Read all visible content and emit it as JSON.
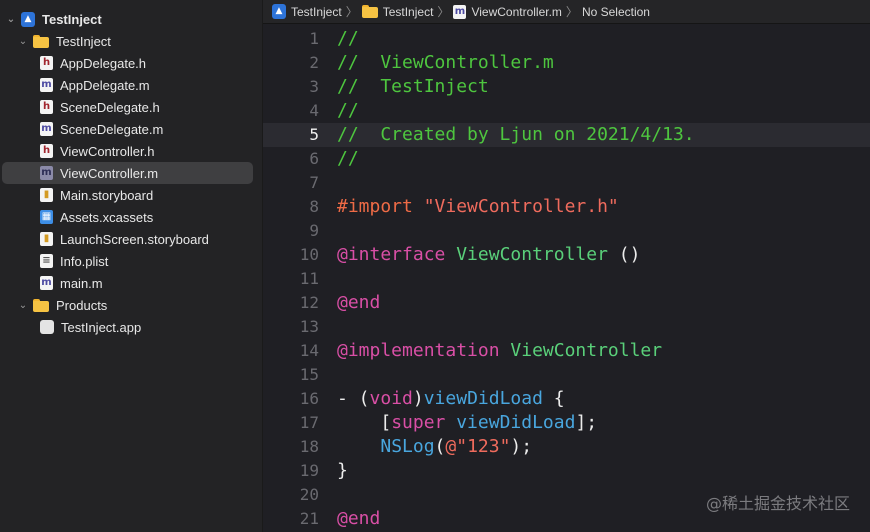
{
  "navigator": {
    "items": [
      {
        "label": "TestInject",
        "icon": "xcode-project-icon",
        "chevron": "⌄",
        "depth": 0,
        "bold": true
      },
      {
        "label": "TestInject",
        "icon": "folder-icon",
        "chevron": "⌄",
        "depth": 1
      },
      {
        "label": "AppDelegate.h",
        "icon": "header-file-icon",
        "badge": "h",
        "depth": 2
      },
      {
        "label": "AppDelegate.m",
        "icon": "objc-file-icon",
        "badge": "m",
        "depth": 2
      },
      {
        "label": "SceneDelegate.h",
        "icon": "header-file-icon",
        "badge": "h",
        "depth": 2
      },
      {
        "label": "SceneDelegate.m",
        "icon": "objc-file-icon",
        "badge": "m",
        "depth": 2
      },
      {
        "label": "ViewController.h",
        "icon": "header-file-icon",
        "badge": "h",
        "depth": 2
      },
      {
        "label": "ViewController.m",
        "icon": "objc-file-icon",
        "badge": "m",
        "depth": 2,
        "selected": true
      },
      {
        "label": "Main.storyboard",
        "icon": "storyboard-file-icon",
        "depth": 2
      },
      {
        "label": "Assets.xcassets",
        "icon": "asset-catalog-icon",
        "depth": 2
      },
      {
        "label": "LaunchScreen.storyboard",
        "icon": "storyboard-file-icon",
        "depth": 2
      },
      {
        "label": "Info.plist",
        "icon": "plist-file-icon",
        "depth": 2
      },
      {
        "label": "main.m",
        "icon": "objc-file-icon",
        "badge": "m",
        "depth": 2
      },
      {
        "label": "Products",
        "icon": "folder-icon",
        "chevron": "⌄",
        "depth": 1
      },
      {
        "label": "TestInject.app",
        "icon": "app-product-icon",
        "depth": 2
      }
    ]
  },
  "breadcrumb": {
    "items": [
      {
        "label": "TestInject",
        "icon": "xcode-project-icon"
      },
      {
        "label": "TestInject",
        "icon": "folder-icon"
      },
      {
        "label": "ViewController.m",
        "icon": "objc-file-icon"
      },
      {
        "label": "No Selection"
      }
    ],
    "separator": "〉"
  },
  "editor": {
    "current_line": 5,
    "lines": [
      {
        "n": "1",
        "tokens": [
          [
            "c-comment",
            "//"
          ]
        ]
      },
      {
        "n": "2",
        "tokens": [
          [
            "c-comment",
            "//  ViewController.m"
          ]
        ]
      },
      {
        "n": "3",
        "tokens": [
          [
            "c-comment",
            "//  TestInject"
          ]
        ]
      },
      {
        "n": "4",
        "tokens": [
          [
            "c-comment",
            "//"
          ]
        ]
      },
      {
        "n": "5",
        "tokens": [
          [
            "c-comment",
            "//  Created by Ljun on 2021/4/13."
          ]
        ]
      },
      {
        "n": "6",
        "tokens": [
          [
            "c-comment",
            "//"
          ]
        ]
      },
      {
        "n": "7",
        "tokens": []
      },
      {
        "n": "8",
        "tokens": [
          [
            "c-pre",
            "#import "
          ],
          [
            "c-str",
            "\"ViewController.h\""
          ]
        ]
      },
      {
        "n": "9",
        "tokens": []
      },
      {
        "n": "10",
        "tokens": [
          [
            "c-kw",
            "@interface "
          ],
          [
            "c-cls",
            "ViewController"
          ],
          [
            "c-plain",
            " ()"
          ]
        ]
      },
      {
        "n": "11",
        "tokens": []
      },
      {
        "n": "12",
        "tokens": [
          [
            "c-kw",
            "@end"
          ]
        ]
      },
      {
        "n": "13",
        "tokens": []
      },
      {
        "n": "14",
        "tokens": [
          [
            "c-kw",
            "@implementation "
          ],
          [
            "c-cls",
            "ViewController"
          ]
        ]
      },
      {
        "n": "15",
        "tokens": []
      },
      {
        "n": "16",
        "tokens": [
          [
            "c-plain",
            "- ("
          ],
          [
            "c-kw",
            "void"
          ],
          [
            "c-plain",
            ")"
          ],
          [
            "c-fn",
            "viewDidLoad"
          ],
          [
            "c-plain",
            " {"
          ]
        ]
      },
      {
        "n": "17",
        "tokens": [
          [
            "c-plain",
            "    ["
          ],
          [
            "c-kw",
            "super"
          ],
          [
            "c-plain",
            " "
          ],
          [
            "c-fn",
            "viewDidLoad"
          ],
          [
            "c-plain",
            "];"
          ]
        ]
      },
      {
        "n": "18",
        "tokens": [
          [
            "c-plain",
            "    "
          ],
          [
            "c-fn",
            "NSLog"
          ],
          [
            "c-plain",
            "("
          ],
          [
            "c-str",
            "@\"123\""
          ],
          [
            "c-plain",
            ");"
          ]
        ]
      },
      {
        "n": "19",
        "tokens": [
          [
            "c-plain",
            "}"
          ]
        ]
      },
      {
        "n": "20",
        "tokens": []
      },
      {
        "n": "21",
        "tokens": [
          [
            "c-kw",
            "@end"
          ]
        ]
      }
    ]
  },
  "watermark": "@稀土掘金技术社区"
}
